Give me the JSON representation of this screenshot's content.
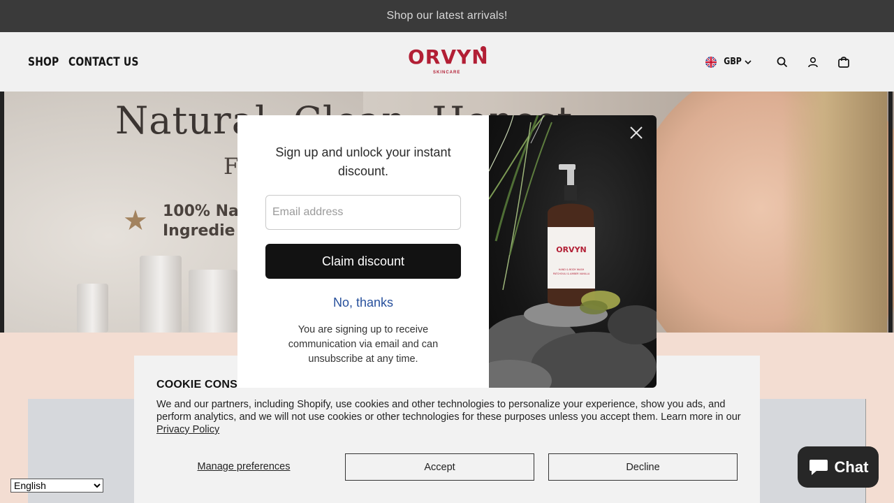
{
  "announcement": "Shop our latest arrivals!",
  "header": {
    "nav": [
      "SHOP",
      "CONTACT US"
    ],
    "logo": {
      "name": "ORVYN",
      "sub": "SKINCARE",
      "color": "#b21f35"
    },
    "currency": "GBP"
  },
  "hero": {
    "title": "Natural, Clean, Honest",
    "subtitle": "Fo",
    "feature": "100% Na\nIngredie"
  },
  "popup": {
    "heading": "Sign up and unlock your instant discount.",
    "email_placeholder": "Email address",
    "claim_label": "Claim discount",
    "decline_label": "No, thanks",
    "fine_print": "You are signing up to receive communication via email and can unsubscribe at any time.",
    "product_brand": "ORVYN",
    "product_line1": "HAND & BODY WASH",
    "product_line2": "PATCHOULI & AMBER VANILLA"
  },
  "cookie": {
    "title": "COOKIE CONSENT",
    "text_before": "We and our partners, including Shopify, use cookies and other technologies to personalize your experience, show you ads, and perform analytics, and we will not use cookies or other technologies for these purposes unless you accept them. Learn more in our ",
    "privacy_link": "Privacy Policy",
    "manage_label": "Manage preferences",
    "accept_label": "Accept",
    "decline_label": "Decline"
  },
  "chat": {
    "label": "Chat"
  },
  "language": {
    "selected": "English"
  },
  "colors": {
    "announcement_bg": "#3a3a3a",
    "brand": "#b21f35",
    "claim_button": "#121212",
    "link_blue": "#27509c",
    "chat_bg": "#272727"
  }
}
